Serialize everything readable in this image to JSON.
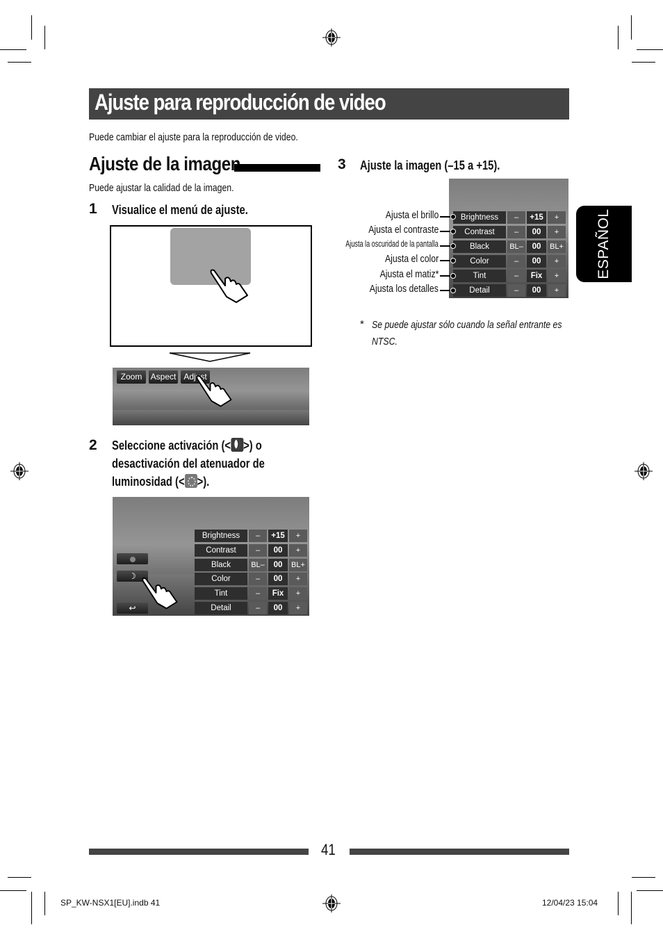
{
  "page": {
    "title": "Ajuste para reproducción de video",
    "intro": "Puede cambiar el ajuste para la reproducción de video.",
    "language_tab": "ESPAÑOL",
    "page_number": "41"
  },
  "section": {
    "heading": "Ajuste de la imagen",
    "intro": "Puede ajustar la calidad de la imagen."
  },
  "steps": [
    {
      "number": "1",
      "text": "Visualice el menú de ajuste."
    },
    {
      "number": "2",
      "text_lines": [
        "Seleccione activación (<",
        ">) o",
        "desactivación del atenuador de",
        "luminosidad (<",
        ">)."
      ],
      "icons": [
        "dimmer-on-moon-icon",
        "dimmer-off-sun-icon"
      ]
    },
    {
      "number": "3",
      "text": "Ajuste la imagen (–15 a +15)."
    }
  ],
  "screen1": {
    "buttons": [
      "Zoom",
      "Aspect",
      "Adjust"
    ]
  },
  "adjust_menu": {
    "rows": [
      {
        "label": "Brightness",
        "value": "+15",
        "minus_icon": "sun-minus-icon",
        "plus_icon": "sun-plus-icon"
      },
      {
        "label": "Contrast",
        "value": "00",
        "minus_icon": "contrast-minus-icon",
        "plus_icon": "contrast-plus-icon"
      },
      {
        "label": "Black",
        "value": "00",
        "minus_icon": "black-minus-icon",
        "plus_icon": "black-plus-icon"
      },
      {
        "label": "Color",
        "value": "00",
        "minus_icon": "color-minus-icon",
        "plus_icon": "color-plus-icon"
      },
      {
        "label": "Tint",
        "value": "Fix",
        "minus_icon": "tint-minus-icon",
        "plus_icon": "tint-plus-icon"
      },
      {
        "label": "Detail",
        "value": "00",
        "minus_icon": "detail-minus-icon",
        "plus_icon": "detail-plus-icon"
      }
    ],
    "side_buttons": [
      "dimmer-off-sun-icon",
      "dimmer-on-moon-icon",
      "back-arrow-icon"
    ],
    "minus_glyph": "–",
    "plus_glyph": "+",
    "bl_glyph": "BL"
  },
  "callouts": [
    "Ajusta el brillo",
    "Ajusta el contraste",
    "Ajusta la oscuridad de la pantalla",
    "Ajusta el color",
    "Ajusta el matiz*",
    "Ajusta los detalles"
  ],
  "footnote": {
    "marker": "*",
    "text_line1": "Se puede ajustar sólo cuando la señal entrante es",
    "text_line2": "NTSC."
  },
  "slug": {
    "file": "SP_KW-NSX1[EU].indb   41",
    "datetime": "12/04/23   15:04"
  }
}
